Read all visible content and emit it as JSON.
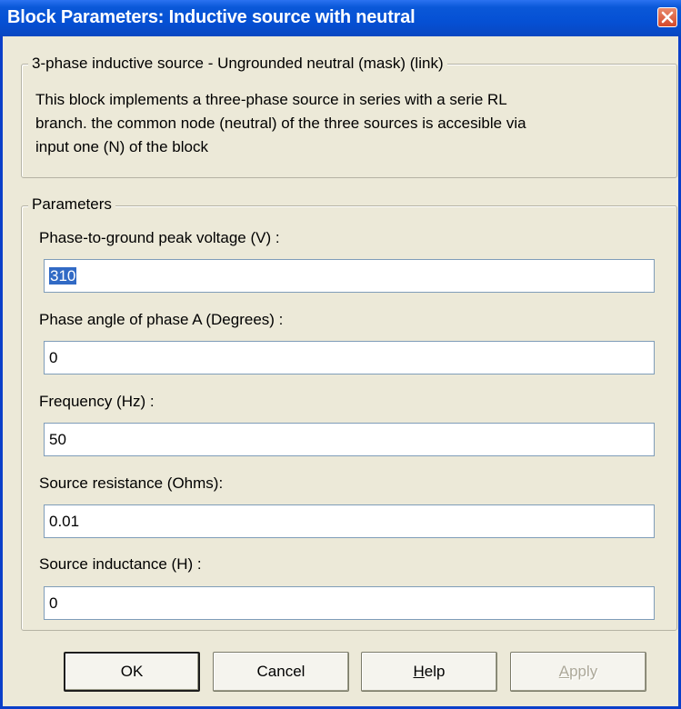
{
  "window": {
    "title": "Block Parameters: Inductive source with neutral",
    "colors": {
      "titlebar": "#0550d4",
      "close_button": "#d4482a",
      "dialog_bg": "#ece9d8"
    }
  },
  "block": {
    "header": "3-phase inductive source - Ungrounded neutral (mask) (link)",
    "description_lines": [
      "This block implements a three-phase source in series with a serie RL",
      "branch. the common node  (neutral)  of the three sources is accesible via",
      "input one (N)  of the block"
    ]
  },
  "parameters": {
    "legend": "Parameters",
    "fields": [
      {
        "label": "Phase-to-ground peak voltage (V) :",
        "value": "310",
        "selected": true
      },
      {
        "label": "Phase angle of phase A (Degrees) :",
        "value": "0"
      },
      {
        "label": "Frequency (Hz) :",
        "value": "50"
      },
      {
        "label": "Source resistance (Ohms):",
        "value": "0.01"
      },
      {
        "label": "Source inductance (H) :",
        "value": "0"
      }
    ]
  },
  "buttons": {
    "ok": "OK",
    "cancel": "Cancel",
    "help": "Help",
    "apply": "Apply",
    "apply_enabled": false
  }
}
